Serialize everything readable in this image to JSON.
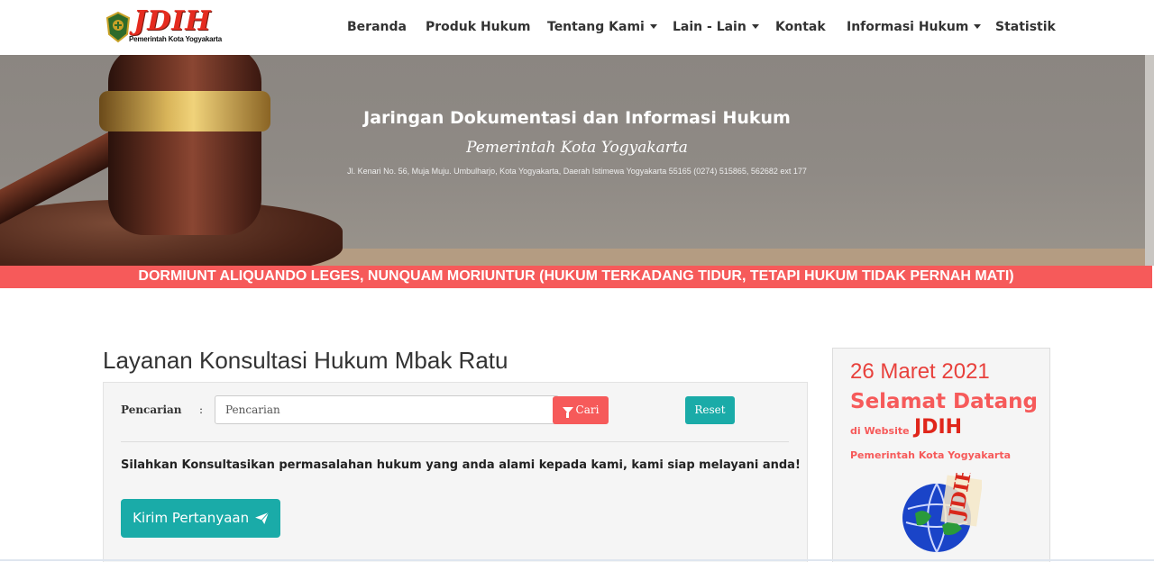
{
  "header": {
    "logo_text": "JDIH",
    "logo_subtitle": "Pemerintah Kota Yogyakarta",
    "nav": [
      {
        "label": "Beranda",
        "dropdown": false
      },
      {
        "label": "Produk Hukum",
        "dropdown": false
      },
      {
        "label": "Tentang Kami",
        "dropdown": true
      },
      {
        "label": "Lain - Lain",
        "dropdown": true
      },
      {
        "label": "Kontak",
        "dropdown": false
      },
      {
        "label": "Informasi Hukum",
        "dropdown": true
      },
      {
        "label": "Statistik",
        "dropdown": false
      }
    ]
  },
  "hero": {
    "title": "Jaringan Dokumentasi dan Informasi Hukum",
    "subtitle": "Pemerintah Kota Yogyakarta",
    "address": "Jl. Kenari No. 56, Muja Muju. Umbulharjo, Kota Yogyakarta, Daerah Istimewa Yogyakarta 55165 (0274) 515865, 562682 ext 177"
  },
  "motto": "DORMIUNT ALIQUANDO LEGES, NUNQUAM MORIUNTUR (HUKUM TERKADANG TIDUR, TETAPI HUKUM TIDAK PERNAH MATI)",
  "main": {
    "title": "Layanan Konsultasi Hukum Mbak Ratu",
    "search": {
      "label": "Pencarian",
      "colon": ":",
      "placeholder": "Pencarian",
      "search_button": "Cari",
      "reset_button": "Reset"
    },
    "notice": "Silahkan Konsultasikan permasalahan hukum yang anda alami kepada kami, kami siap melayani anda!",
    "send_button": "Kirim Pertanyaan"
  },
  "sidebar": {
    "date": "26 Maret 2021",
    "welcome": "Selamat Datang",
    "website_prefix": "di Website",
    "website_name": "JDIH",
    "government": "Pemerintah Kota Yogyakarta",
    "globe_logo_text": "JDIH"
  },
  "colors": {
    "accent_red": "#f65a5a",
    "teal": "#1aaba8",
    "logo_red": "#e52b1f"
  }
}
